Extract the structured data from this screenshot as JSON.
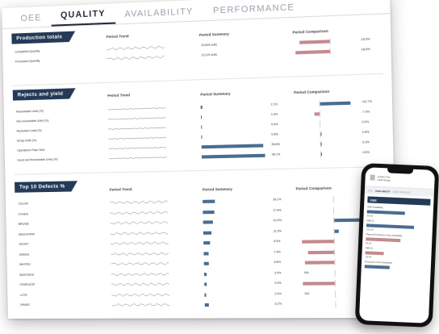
{
  "tabs": [
    {
      "label": "OEE",
      "active": false
    },
    {
      "label": "QUALITY",
      "active": true
    },
    {
      "label": "AVAILABILITY",
      "active": false
    },
    {
      "label": "PERFORMANCE",
      "active": false
    }
  ],
  "colors": {
    "header_navy": "#243a57",
    "bar_blue": "#4a6d92",
    "bar_red": "#c48a8d"
  },
  "production_totals": {
    "title": "Production totals",
    "col_trend": "Period Trend",
    "col_summary": "Period Summary",
    "col_compare": "Period Comparison",
    "rows": [
      {
        "label": "Completed Quantity",
        "summary": "23,834 units",
        "compare": -16.5,
        "compare_label": "-16.5%"
      },
      {
        "label": "Processed Quantity",
        "summary": "23,119 units",
        "compare": -18.8,
        "compare_label": "-18.8%"
      }
    ]
  },
  "rejects_yield": {
    "title": "Rejects and yield",
    "col_trend": "Period Trend",
    "col_summary": "Period Summary",
    "col_compare": "Period Comparison",
    "rows": [
      {
        "label": "Reworkable Units (%)",
        "summary": 2.1,
        "summary_label": "2.1%",
        "compare": 42.7,
        "compare_label": "+42.7%"
      },
      {
        "label": "Non-reworkable Units (%)",
        "summary": 1.9,
        "summary_label": "1.9%",
        "compare": -7.4,
        "compare_label": "-7.4%"
      },
      {
        "label": "Reworked Units (%)",
        "summary": 0.0,
        "summary_label": "0.0%",
        "compare": 0.0,
        "compare_label": "0.0%"
      },
      {
        "label": "Scrap Units (%)",
        "summary": 0.8,
        "summary_label": "0.8%",
        "compare": 0.8,
        "compare_label": "0.8%"
      },
      {
        "label": "Operations Pass Yield",
        "summary": 95.8,
        "summary_label": "95.8%",
        "compare": 0.3,
        "compare_label": "0.3%"
      },
      {
        "label": "Good and Reworkable Units (%)",
        "summary": 98.1,
        "summary_label": "98.1%",
        "compare": 0.6,
        "compare_label": "0.6%"
      }
    ]
  },
  "top_defects": {
    "title": "Top 10 Defects %",
    "col_trend": "Period Trend",
    "col_summary": "Period Summary",
    "col_compare": "Period Comparison",
    "rows": [
      {
        "label": "COLOR",
        "summary": 18.1,
        "summary_label": "18.1%",
        "compare": 0,
        "compare_label": ""
      },
      {
        "label": "OTHER",
        "summary": 17.6,
        "summary_label": "17.6%",
        "compare": 0,
        "compare_label": ""
      },
      {
        "label": "BRUISE",
        "summary": 14.9,
        "summary_label": "14.9%",
        "compare": 20,
        "compare_label": ""
      },
      {
        "label": "BACKSTRIP",
        "summary": 11.9,
        "summary_label": "11.9%",
        "compare": 3,
        "compare_label": ""
      },
      {
        "label": "SKORT",
        "summary": 9.5,
        "summary_label": "9.5%",
        "compare": -22,
        "compare_label": ""
      },
      {
        "label": "GREEN",
        "summary": 7.9,
        "summary_label": "7.9%",
        "compare": -18,
        "compare_label": ""
      },
      {
        "label": "WHITED",
        "summary": 6.8,
        "summary_label": "6.8%",
        "compare": -20,
        "compare_label": ""
      },
      {
        "label": "BACKSKIN",
        "summary": 3.9,
        "summary_label": "3.9%",
        "compare": 0,
        "compare_label": "N/A"
      },
      {
        "label": "CRAPLEOP",
        "summary": 3.3,
        "summary_label": "3.3%",
        "compare": -22,
        "compare_label": ""
      },
      {
        "label": "LOTE",
        "summary": 2.4,
        "summary_label": "2.4%",
        "compare": 0,
        "compare_label": "N/A"
      },
      {
        "label": "DRAVE",
        "summary": 6.2,
        "summary_label": "6.2%",
        "compare": 0,
        "compare_label": ""
      }
    ]
  },
  "phone": {
    "header_line1": "Quality Hub",
    "header_line2": "OEE Widget",
    "tabs": [
      "OEE",
      "AVAILABILITY",
      "PERFORMANCE"
    ],
    "active_tab": "AVAILABILITY",
    "section_title": "OEE",
    "rows": [
      {
        "label": "OEE Availability",
        "value": "56.0%",
        "fill": 0.6,
        "color": "#4a6d92"
      },
      {
        "label": "OEE %",
        "value": "+55.2%",
        "fill": 0.75,
        "color": "#4a6d92"
      },
      {
        "label": "Planned Production Time Availability",
        "value": "48.1%",
        "fill": 0.55,
        "color": "#c48a8d"
      },
      {
        "label": "OEE %",
        "value": "-23.4%",
        "fill": 0.3,
        "color": "#c48a8d"
      },
      {
        "label": "Production Time Availability",
        "value": "",
        "fill": 0.4,
        "color": "#4a6d92"
      }
    ]
  }
}
